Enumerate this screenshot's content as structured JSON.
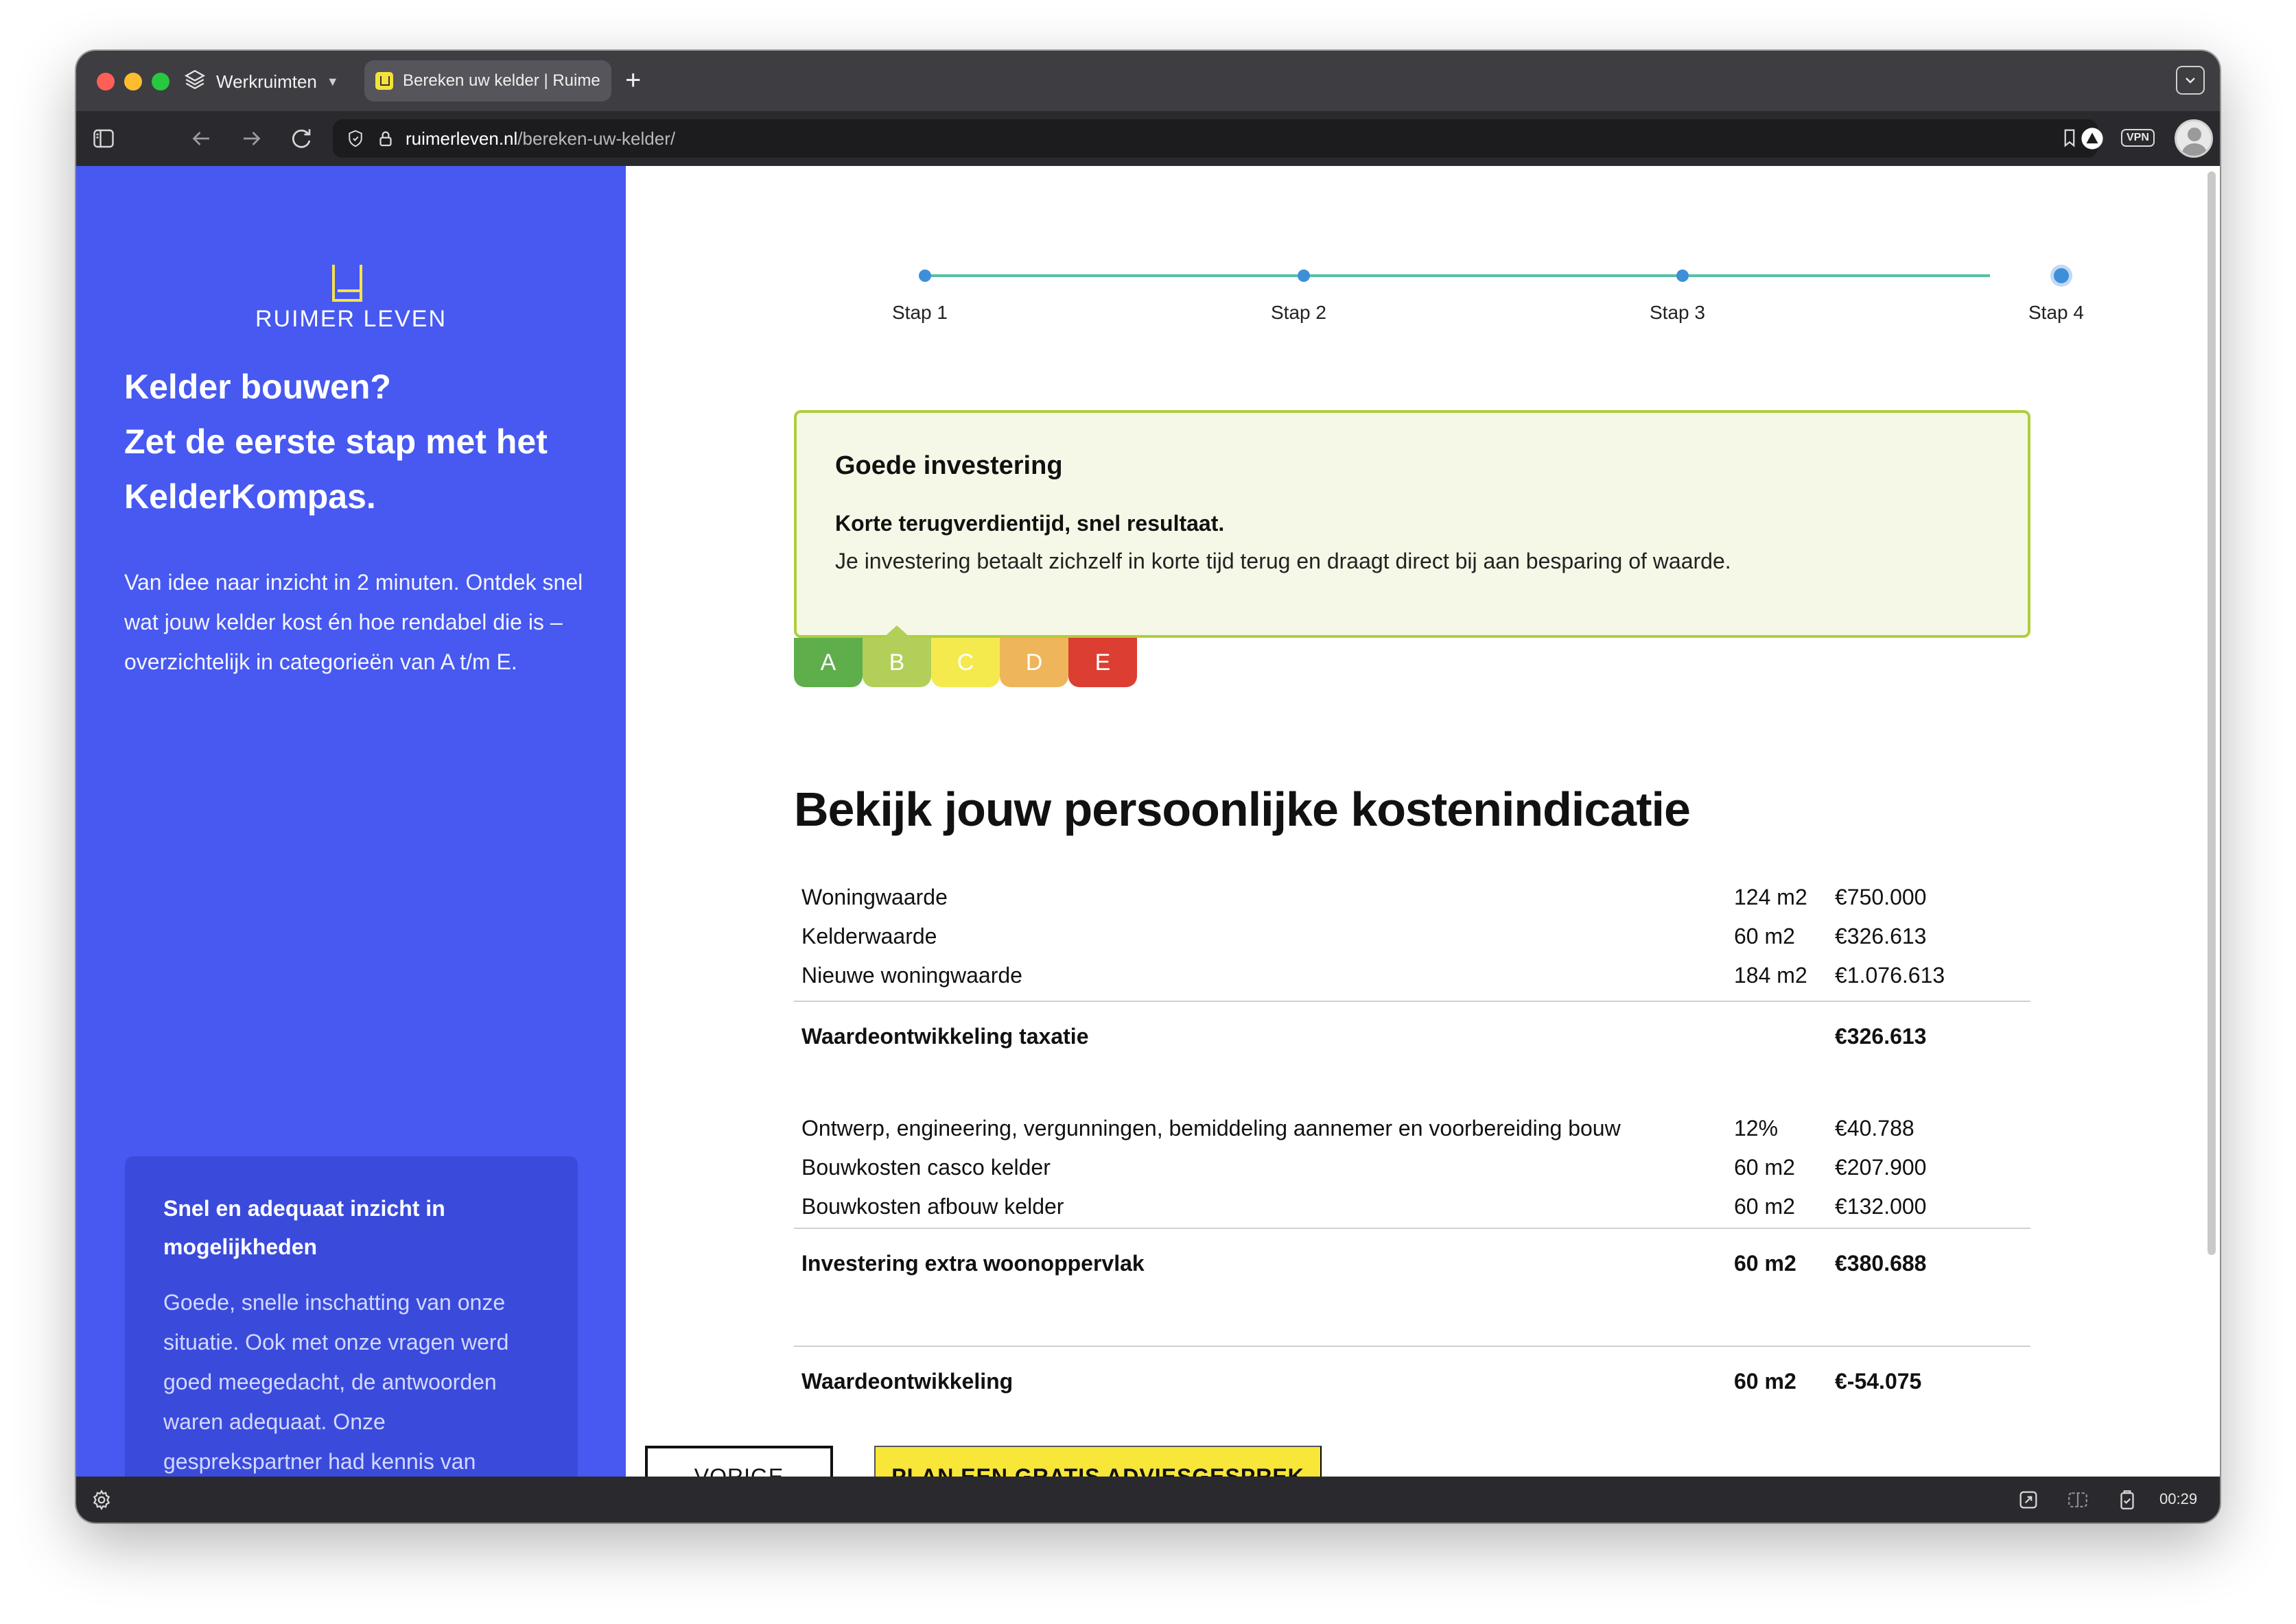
{
  "browser": {
    "workspaces_label": "Werkruimten",
    "tab_title": "Bereken uw kelder | Ruimer Leven",
    "url_host": "ruimerleven.nl",
    "url_path": "/bereken-uw-kelder/",
    "vpn_label": "VPN",
    "clock": "00:29"
  },
  "sidebar": {
    "logo_text": "RUIMER LEVEN",
    "title_lines": [
      "Kelder bouwen?",
      "Zet de eerste stap met het",
      "KelderKompas."
    ],
    "intro": "Van idee naar inzicht in 2 minuten. Ontdek snel wat jouw kelder kost én hoe rendabel die is – overzichtelijk in categorieën van A t/m E.",
    "review_title": "Snel en adequaat inzicht in mogelijkheden",
    "review_text": "Goede, snelle inschatting van onze situatie. Ook met onze vragen werd goed meegedacht, de antwoorden waren adequaat. Onze gesprekspartner had kennis van zaken. Kortom, een inzichtgevend"
  },
  "stepper": {
    "steps": [
      "Stap 1",
      "Stap 2",
      "Stap 3",
      "Stap 4"
    ],
    "current_step": 4
  },
  "rating": {
    "heading": "Goede investering",
    "subheading": "Korte terugverdientijd, snel resultaat.",
    "description": "Je investering betaalt zichzelf in korte tijd terug en draagt direct bij aan besparing of waarde.",
    "grades": [
      "A",
      "B",
      "C",
      "D",
      "E"
    ],
    "grade_colors": [
      "#5fae4c",
      "#b2cf5a",
      "#f4ea4e",
      "#efb55a",
      "#dc3e31"
    ],
    "active_grade": "B"
  },
  "costs": {
    "title": "Bekijk jouw persoonlijke kostenindicatie",
    "value_rows": [
      {
        "label": "Woningwaarde",
        "qty": "124 m2",
        "amount": "€750.000"
      },
      {
        "label": "Kelderwaarde",
        "qty": "60 m2",
        "amount": "€326.613"
      },
      {
        "label": "Nieuwe woningwaarde",
        "qty": "184 m2",
        "amount": "€1.076.613"
      }
    ],
    "value_total": {
      "label": "Waardeontwikkeling taxatie",
      "qty": "",
      "amount": "€326.613"
    },
    "cost_rows": [
      {
        "label": "Ontwerp, engineering, vergunningen, bemiddeling aannemer en voorbereiding bouw",
        "qty": "12%",
        "amount": "€40.788"
      },
      {
        "label": "Bouwkosten casco kelder",
        "qty": "60 m2",
        "amount": "€207.900"
      },
      {
        "label": "Bouwkosten afbouw kelder",
        "qty": "60 m2",
        "amount": "€132.000"
      }
    ],
    "cost_total": {
      "label": "Investering extra woonoppervlak",
      "qty": "60 m2",
      "amount": "€380.688"
    },
    "final": {
      "label": "Waardeontwikkeling",
      "qty": "60 m2",
      "amount": "€-54.075"
    }
  },
  "actions": {
    "prev_label": "VORIGE",
    "cta_label": "PLAN EEN GRATIS ADVIESGESPREK"
  }
}
